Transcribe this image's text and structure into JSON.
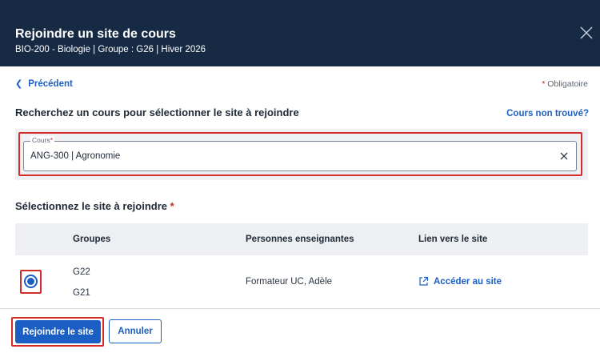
{
  "header": {
    "title": "Rejoindre un site de cours",
    "subtitle": "BIO-200 - Biologie | Groupe : G26 | Hiver 2026",
    "close_icon": "close-icon"
  },
  "nav": {
    "back_label": "Précédent",
    "required_star": "*",
    "required_label": "Obligatoire"
  },
  "search": {
    "title": "Recherchez un cours pour sélectionner le site à rejoindre",
    "not_found_label": "Cours non trouvé?",
    "field_label": "Cours",
    "field_star": "*",
    "field_value": "ANG-300 | Agronomie",
    "clear_icon": "clear-icon"
  },
  "select": {
    "title": "Sélectionnez le site à rejoindre",
    "star": "*",
    "columns": {
      "groups": "Groupes",
      "teachers": "Personnes enseignantes",
      "link": "Lien vers le site"
    },
    "rows": [
      {
        "groups": [
          "G22",
          "G21"
        ],
        "teacher": "Formateur UC, Adèle",
        "link_label": "Accéder au site",
        "selected": true
      }
    ]
  },
  "footer": {
    "join_label": "Rejoindre le site",
    "cancel_label": "Annuler"
  },
  "colors": {
    "header_bg": "#172a44",
    "accent": "#1b5fc4",
    "highlight": "#d42b2b",
    "required": "#c92a2a"
  }
}
